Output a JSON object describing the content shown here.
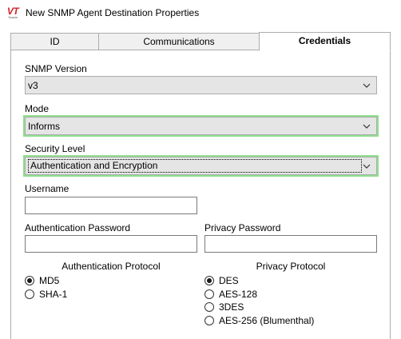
{
  "window": {
    "title": "New SNMP Agent Destination Properties",
    "logo_text": "VT",
    "logo_subtext": "Scada"
  },
  "tabs": [
    {
      "label": "ID",
      "active": false
    },
    {
      "label": "Communications",
      "active": false
    },
    {
      "label": "Credentials",
      "active": true
    }
  ],
  "credentials": {
    "snmp_version": {
      "label": "SNMP Version",
      "value": "v3"
    },
    "mode": {
      "label": "Mode",
      "value": "Informs"
    },
    "security_level": {
      "label": "Security Level",
      "value": "Authentication and Encryption"
    },
    "username": {
      "label": "Username",
      "value": ""
    },
    "auth_password": {
      "label": "Authentication Password",
      "value": ""
    },
    "privacy_password": {
      "label": "Privacy Password",
      "value": ""
    },
    "auth_protocol": {
      "title": "Authentication Protocol",
      "options": [
        {
          "label": "MD5",
          "checked": true
        },
        {
          "label": "SHA-1",
          "checked": false
        }
      ]
    },
    "privacy_protocol": {
      "title": "Privacy Protocol",
      "options": [
        {
          "label": "DES",
          "checked": true
        },
        {
          "label": "AES-128",
          "checked": false
        },
        {
          "label": "3DES",
          "checked": false
        },
        {
          "label": "AES-256 (Blumenthal)",
          "checked": false
        }
      ]
    }
  },
  "colors": {
    "highlight_outline": "#8ee08e",
    "logo_red": "#d4242b"
  }
}
